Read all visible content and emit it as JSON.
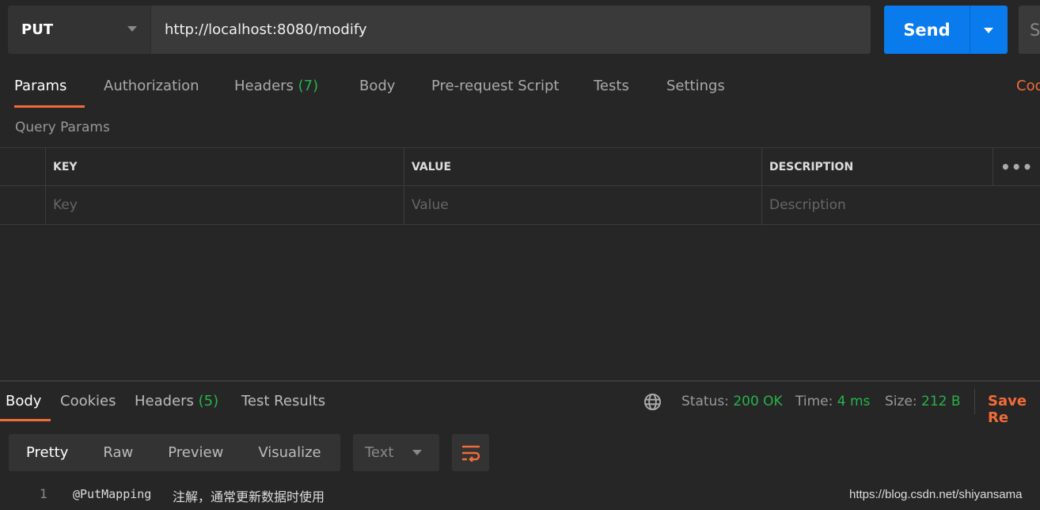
{
  "request": {
    "method": "PUT",
    "url": "http://localhost:8080/modify",
    "send_label": "Send",
    "save_label_partial": "S"
  },
  "tabs": [
    {
      "label": "Params"
    },
    {
      "label": "Authorization"
    },
    {
      "label": "Headers",
      "count": "(7)"
    },
    {
      "label": "Body"
    },
    {
      "label": "Pre-request Script"
    },
    {
      "label": "Tests"
    },
    {
      "label": "Settings"
    }
  ],
  "cookies_link_partial": "Coo",
  "query_params": {
    "title": "Query Params",
    "columns": [
      "KEY",
      "VALUE",
      "DESCRIPTION"
    ],
    "placeholders": {
      "key": "Key",
      "value": "Value",
      "description": "Description"
    }
  },
  "response": {
    "tabs": [
      {
        "label": "Body"
      },
      {
        "label": "Cookies"
      },
      {
        "label": "Headers",
        "count": "(5)"
      },
      {
        "label": "Test Results"
      }
    ],
    "status_label": "Status:",
    "status": "200 OK",
    "time_label": "Time:",
    "time": "4 ms",
    "size_label": "Size:",
    "size": "212 B",
    "save_partial": "Save Re",
    "views": [
      "Pretty",
      "Raw",
      "Preview",
      "Visualize"
    ],
    "format": "Text",
    "lines": [
      {
        "num": "1",
        "code": "@PutMapping",
        "text": "注解，通常更新数据时使用"
      }
    ]
  },
  "watermark": "https://blog.csdn.net/shiyansama",
  "colors": {
    "accent": "#f26b3a",
    "send": "#097bed",
    "success": "#26b34a"
  }
}
